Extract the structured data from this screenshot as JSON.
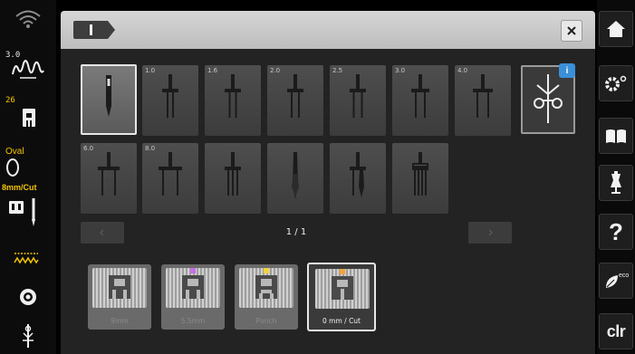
{
  "status_bar": {
    "stitch_width": "3.0",
    "stitch_length": "26",
    "hoop_label": "Oval",
    "presser_foot_label": "8mm/Cut"
  },
  "dialog": {
    "needle_tiles": [
      {
        "size": "",
        "selected": true,
        "icon": "single-needle-icon"
      },
      {
        "size": "1.0",
        "selected": false,
        "icon": "twin-needle-icon"
      },
      {
        "size": "1.6",
        "selected": false,
        "icon": "twin-needle-icon"
      },
      {
        "size": "2.0",
        "selected": false,
        "icon": "twin-needle-icon"
      },
      {
        "size": "2.5",
        "selected": false,
        "icon": "twin-needle-icon"
      },
      {
        "size": "3.0",
        "selected": false,
        "icon": "twin-needle-icon"
      },
      {
        "size": "4.0",
        "selected": false,
        "icon": "twin-needle-icon"
      },
      {
        "size": "6.0",
        "selected": false,
        "icon": "twin-needle-icon"
      },
      {
        "size": "8.0",
        "selected": false,
        "icon": "twin-needle-icon"
      },
      {
        "size": "",
        "selected": false,
        "icon": "triple-needle-icon"
      },
      {
        "size": "",
        "selected": false,
        "icon": "wing-needle-icon"
      },
      {
        "size": "",
        "selected": false,
        "icon": "double-wing-needle-icon"
      },
      {
        "size": "",
        "selected": false,
        "icon": "quad-needle-icon"
      }
    ],
    "info_badge": "i",
    "pagination": "1 / 1",
    "presser_feet": [
      {
        "label": "9mm",
        "selected": false
      },
      {
        "label": "5.5mm",
        "selected": false,
        "marker_color": "#c470e6"
      },
      {
        "label": "Punch",
        "selected": false,
        "marker_color": "#f2d23a"
      },
      {
        "label": "0 mm / Cut",
        "selected": true,
        "marker_color": "#f2a33a"
      }
    ]
  },
  "right_bar": {
    "clear_label": "clr",
    "help_label": "?"
  },
  "colors": {
    "accent_yellow": "#f4c400",
    "info_blue": "#3b8fd8"
  }
}
